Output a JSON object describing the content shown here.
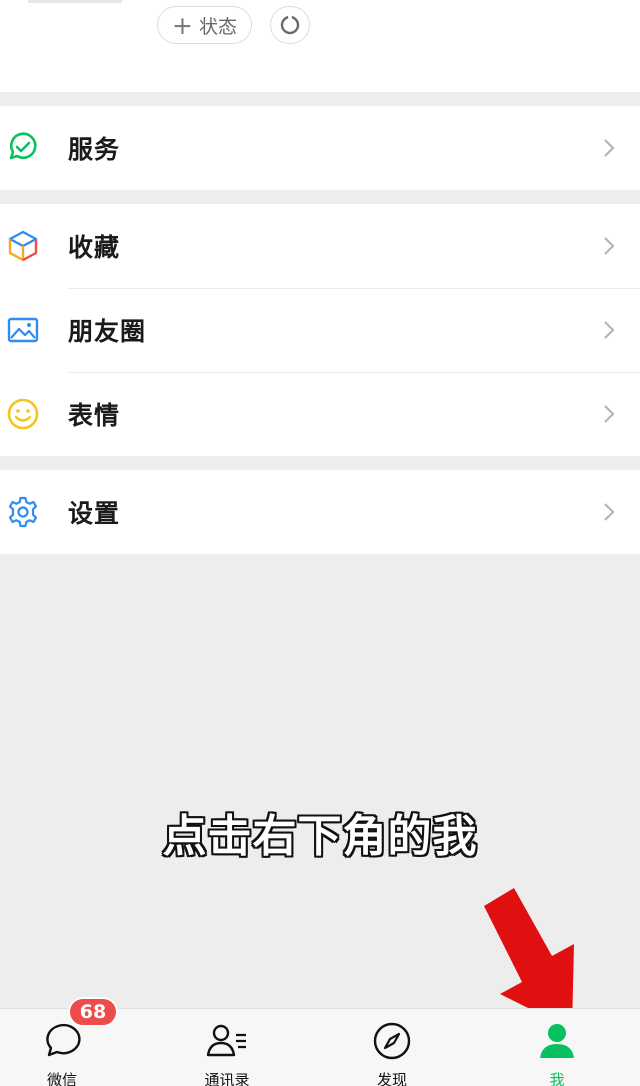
{
  "profile": {
    "status_label": "状态"
  },
  "menu": {
    "services": {
      "label": "服务",
      "icon": "service-icon"
    },
    "favorites": {
      "label": "收藏",
      "icon": "cube-icon"
    },
    "moments": {
      "label": "朋友圈",
      "icon": "photo-icon"
    },
    "stickers": {
      "label": "表情",
      "icon": "smiley-icon"
    },
    "settings": {
      "label": "设置",
      "icon": "gear-icon"
    }
  },
  "caption": "点击右下角的我",
  "tabbar": {
    "chats": {
      "label": "微信",
      "badge": "68",
      "icon": "chat-bubble-icon"
    },
    "contacts": {
      "label": "通讯录",
      "icon": "contacts-icon"
    },
    "discover": {
      "label": "发现",
      "icon": "compass-icon"
    },
    "me": {
      "label": "我",
      "icon": "person-icon",
      "active": true
    }
  },
  "colors": {
    "accent_green": "#07c160",
    "badge_red": "#f04b4b",
    "arrow_red": "#e01010",
    "background": "#ededed"
  }
}
